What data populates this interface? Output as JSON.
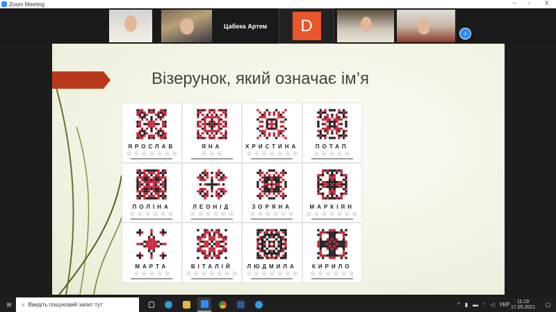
{
  "window": {
    "title": "Zoom Meeting",
    "minimize": "–",
    "maximize": "▫",
    "close": "X"
  },
  "participants": {
    "name_tile": "Цабека Артем",
    "avatar_letter": "D",
    "avatar_color": "#e8562a",
    "next_icon": "chevron-right-icon"
  },
  "slide": {
    "title": "Візерунок, який означає ім’я",
    "names": [
      "ЯРОСЛАВ",
      "ЯНА",
      "ХРИСТИНА",
      "ПОТАП",
      "ПОЛІНА",
      "ЛЕОНІД",
      "ЗОРЯНА",
      "МАРКІЯН",
      "МАРТА",
      "ВІТАЛІЙ",
      "ЛЮДМИЛА",
      "КИРИЛО"
    ]
  },
  "taskbar": {
    "search_placeholder": "Введіть пошуковий запит тут",
    "language": "УКР",
    "time": "11:19",
    "date": "17.05.2021"
  }
}
